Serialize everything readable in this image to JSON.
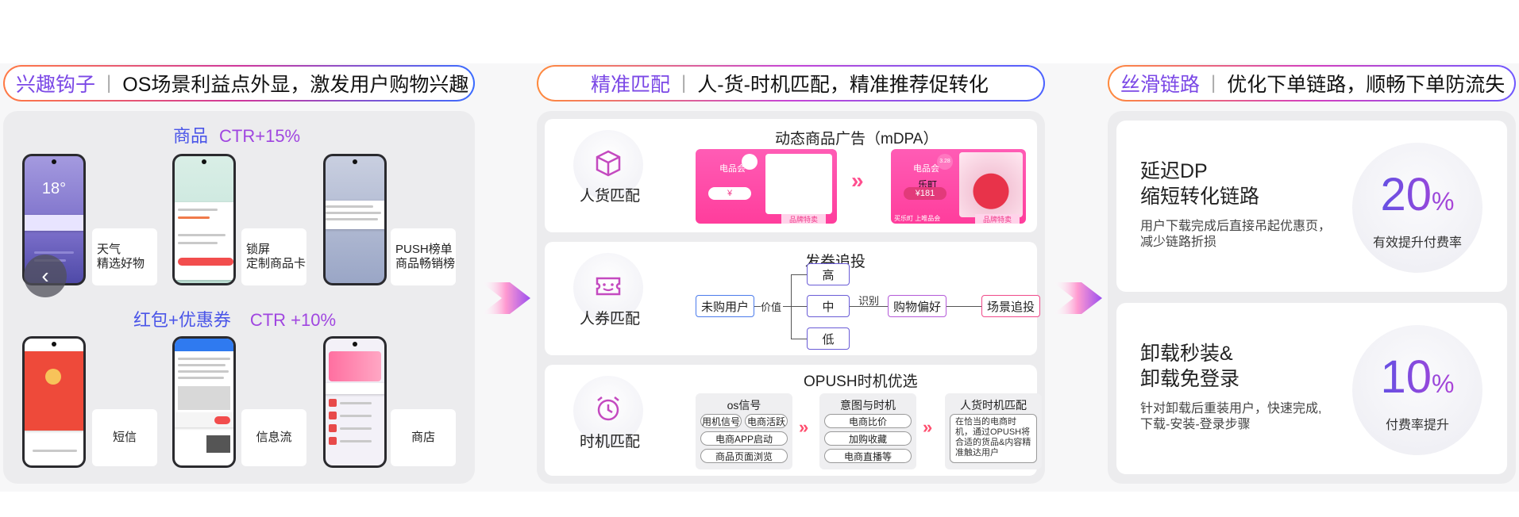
{
  "col1": {
    "accent": "兴趣钩子",
    "sep": "|",
    "rest": "OS场景利益点外显，激发用户购物兴趣"
  },
  "col2": {
    "accent": "精准匹配",
    "sep": "|",
    "rest": "人-货-时机匹配，精准推荐促转化"
  },
  "col3": {
    "accent": "丝滑链路",
    "sep": "|",
    "rest": "优化下单链路，顺畅下单防流失"
  },
  "left": {
    "section1": {
      "title": "商品",
      "metric": "CTR+15%"
    },
    "section2": {
      "title": "红包+优惠券",
      "metric": "CTR +10%"
    },
    "phones": [
      {
        "caption_line1": "天气",
        "caption_line2": "精选好物",
        "temp": "18°"
      },
      {
        "caption_line1": "锁屏",
        "caption_line2": "定制商品卡"
      },
      {
        "caption_line1": "PUSH榜单",
        "caption_line2": "商品畅销榜"
      },
      {
        "caption_line1": "短信"
      },
      {
        "caption_line1": "信息流"
      },
      {
        "caption_line1": "商店"
      }
    ],
    "back_icon": "‹"
  },
  "middle": {
    "row1": {
      "label": "人货匹配",
      "title": "动态商品广告（mDPA）",
      "ad1": {
        "brand": "电品会",
        "price": "¥",
        "tag": "品牌特卖"
      },
      "ad2": {
        "brand": "电品会",
        "name": "乐町",
        "price": "¥181",
        "badge": "3.28",
        "footer": "买乐町 上唯品会",
        "tag": "品牌特卖"
      }
    },
    "row2": {
      "label": "人券匹配",
      "title": "发券追投",
      "nodes": {
        "start": "未购用户",
        "value_label": "价值",
        "high": "高",
        "mid": "中",
        "low": "低",
        "identify_label": "识别",
        "pref": "购物偏好",
        "retarget": "场景追投"
      }
    },
    "row3": {
      "label": "时机匹配",
      "title": "OPUSH时机优选",
      "box1": {
        "title": "os信号",
        "chips": [
          "用机信号",
          "电商活跃",
          "电商APP启动",
          "商品页面浏览"
        ]
      },
      "box2": {
        "title": "意图与时机",
        "chips": [
          "电商比价",
          "加购收藏",
          "电商直播等"
        ]
      },
      "box3": {
        "title": "人货时机匹配",
        "desc": "在恰当的电商时机，通过OPUSH将合适的货品&内容精准触达用户"
      }
    }
  },
  "right": {
    "card1": {
      "title_line1": "延迟DP",
      "title_line2": "缩短转化链路",
      "desc": "用户下载完成后直接吊起优惠页，减少链路折损",
      "stat": "20",
      "unit": "%",
      "stat_label": "有效提升付费率"
    },
    "card2": {
      "title_line1": "卸载秒装&",
      "title_line2": "卸载免登录",
      "desc": "针对卸载后重装用户，快速完成,下载-安装-登录步骤",
      "stat": "10",
      "unit": "%",
      "stat_label": "付费率提升"
    }
  }
}
